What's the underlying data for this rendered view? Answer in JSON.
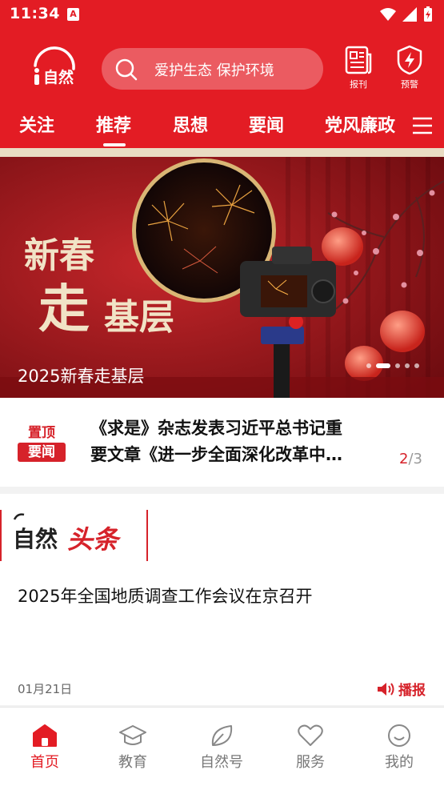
{
  "status_bar": {
    "time": "11:34",
    "notification_badge": "A"
  },
  "header": {
    "logo_text": "i自然",
    "search_placeholder": "爱护生态 保护环境",
    "baokan_label": "报刊",
    "yujing_label": "预警"
  },
  "tabs": [
    {
      "label": "关注"
    },
    {
      "label": "推荐"
    },
    {
      "label": "思想"
    },
    {
      "label": "要闻"
    },
    {
      "label": "党风廉政"
    }
  ],
  "banner": {
    "caption": "2025新春走基层",
    "art_text_1": "新春",
    "art_text_2": "走",
    "art_text_3": "基层",
    "slides": 5,
    "active_slide": 2
  },
  "pinned": {
    "badge_top": "置顶",
    "badge_bottom": "要闻",
    "title_line1": "《求是》杂志发表习近平总书记重",
    "title_line2": "要文章《进一步全面深化改革中…",
    "page_current": "2",
    "page_total": "/3"
  },
  "headline_card": {
    "logo_text_1": "自然",
    "logo_text_2": "头条",
    "title": "2025年全国地质调查工作会议在京召开",
    "date": "01月21日",
    "play_label": "播报"
  },
  "bottom_nav": [
    {
      "label": "首页",
      "icon": "home-icon",
      "active": true
    },
    {
      "label": "教育",
      "icon": "graduation-cap-icon"
    },
    {
      "label": "自然号",
      "icon": "leaf-icon"
    },
    {
      "label": "服务",
      "icon": "heart-icon"
    },
    {
      "label": "我的",
      "icon": "smiley-icon"
    }
  ],
  "colors": {
    "brand_red": "#e31c24",
    "accent_red": "#d6222a",
    "gold": "#e9dcc3"
  }
}
